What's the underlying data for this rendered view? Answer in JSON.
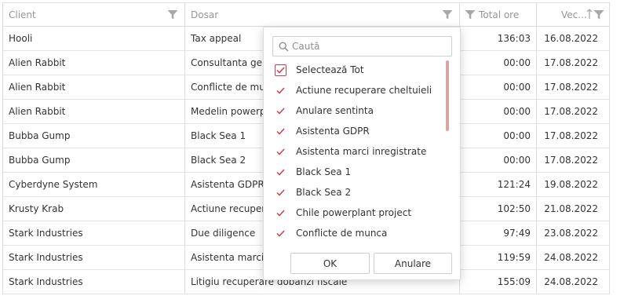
{
  "grid": {
    "columns": [
      {
        "label": "Client"
      },
      {
        "label": "Dosar"
      },
      {
        "label": "Total ore"
      },
      {
        "label": "Vec..."
      }
    ],
    "rows": [
      {
        "client": "Hooli",
        "dosar": "Tax appeal",
        "ore": "136:03",
        "data": "16.08.2022"
      },
      {
        "client": "Alien Rabbit",
        "dosar": "Consultanta gene",
        "ore": "00:00",
        "data": "17.08.2022"
      },
      {
        "client": "Alien Rabbit",
        "dosar": "Conflicte de mun",
        "ore": "00:00",
        "data": "17.08.2022"
      },
      {
        "client": "Alien Rabbit",
        "dosar": "Medelin powerpla",
        "ore": "00:00",
        "data": "17.08.2022"
      },
      {
        "client": "Bubba Gump",
        "dosar": "Black Sea 1",
        "ore": "00:00",
        "data": "17.08.2022"
      },
      {
        "client": "Bubba Gump",
        "dosar": "Black Sea 2",
        "ore": "00:00",
        "data": "17.08.2022"
      },
      {
        "client": "Cyberdyne System",
        "dosar": "Asistenta GDPR",
        "ore": "121:24",
        "data": "19.08.2022"
      },
      {
        "client": "Krusty Krab",
        "dosar": "Actiune recupera",
        "ore": "102:50",
        "data": "21.08.2022"
      },
      {
        "client": "Stark Industries",
        "dosar": "Due diligence",
        "ore": "97:49",
        "data": "23.08.2022"
      },
      {
        "client": "Stark Industries",
        "dosar": "Asistenta marci ir",
        "ore": "119:59",
        "data": "24.08.2022"
      },
      {
        "client": "Stark Industries",
        "dosar": "Litigiu recuperare dobanzi fiscale",
        "ore": "155:09",
        "data": "24.08.2022"
      }
    ]
  },
  "filter_popup": {
    "search_placeholder": "Caută",
    "select_all": "Selectează Tot",
    "items": [
      {
        "label": "Actiune recuperare cheltuieli"
      },
      {
        "label": "Anulare sentinta"
      },
      {
        "label": "Asistenta GDPR"
      },
      {
        "label": "Asistenta marci inregistrate"
      },
      {
        "label": "Black Sea 1"
      },
      {
        "label": "Black Sea 2"
      },
      {
        "label": "Chile powerplant project"
      },
      {
        "label": "Conflicte de munca"
      }
    ],
    "ok_label": "OK",
    "cancel_label": "Anulare"
  },
  "colors": {
    "accent": "#c9404b",
    "scrollbar": "#d8a6a6",
    "header_text": "#959595"
  }
}
